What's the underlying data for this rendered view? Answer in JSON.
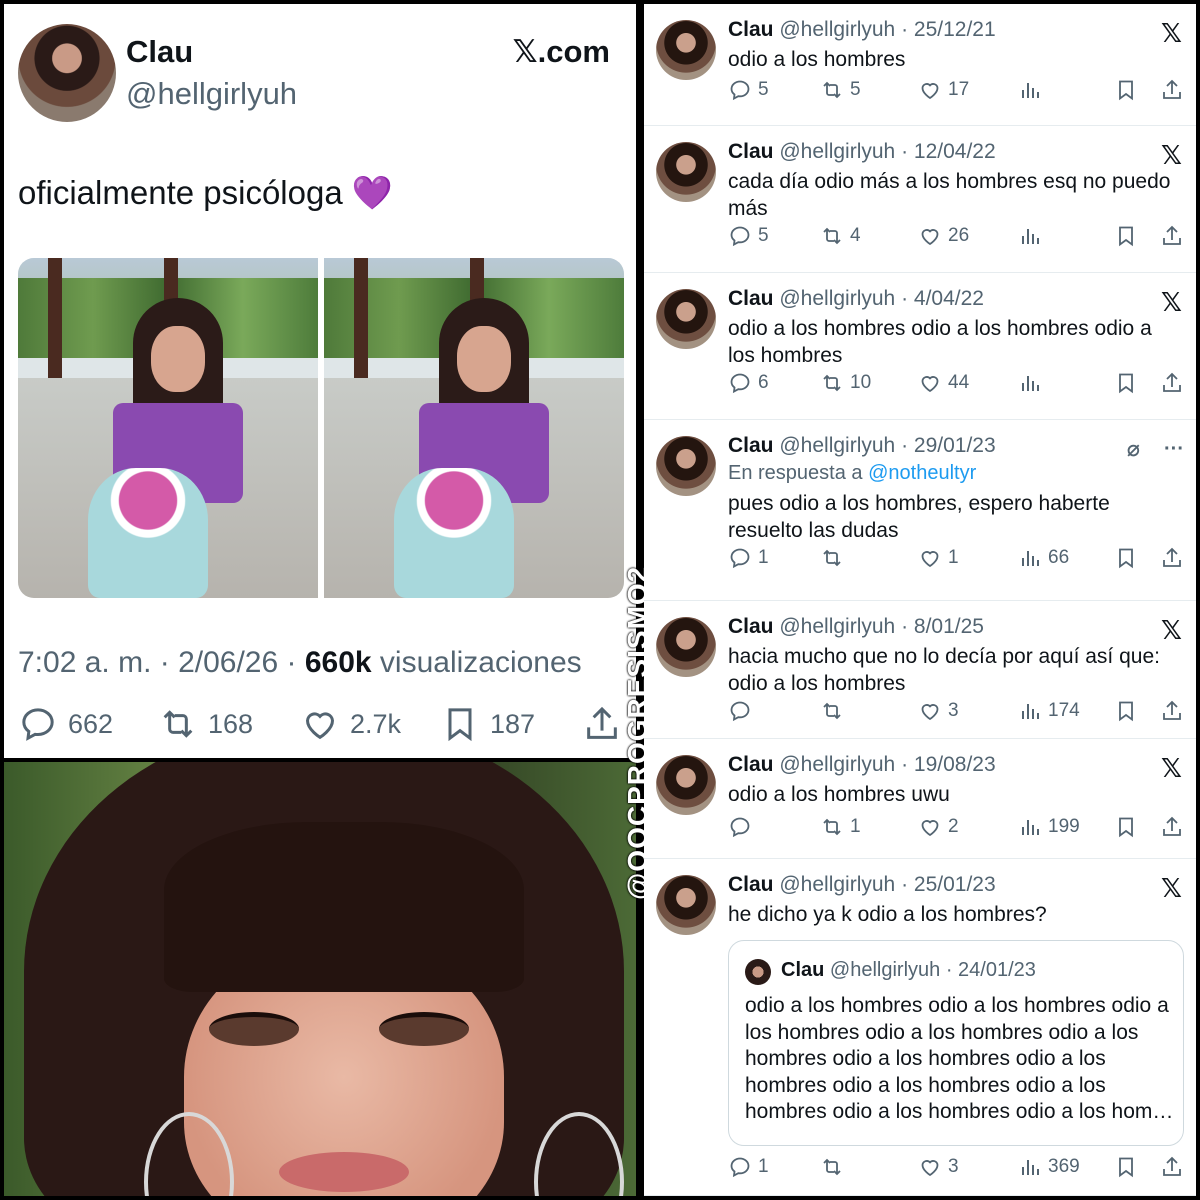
{
  "main": {
    "name": "Clau",
    "handle": "@hellgirlyuh",
    "site": "𝕏.com",
    "text": "oficialmente psicóloga",
    "emoji": "💜",
    "time": "7:02 a. m. · 2/06/26 · ",
    "views_count": "660k",
    "views_label": " visualizaciones",
    "replies": "662",
    "retweets": "168",
    "likes": "2.7k",
    "bookmarks": "187"
  },
  "watermark": "@OOCPROGRESISMO2",
  "tweets": [
    {
      "name": "Clau",
      "handle": "@hellgirlyuh",
      "date": "· 25/12/21",
      "text": "odio a los hombres",
      "replies": "5",
      "retweets": "5",
      "likes": "17",
      "views": ""
    },
    {
      "name": "Clau",
      "handle": "@hellgirlyuh",
      "date": "· 12/04/22",
      "text": "cada día odio más a los hombres esq no puedo más",
      "replies": "5",
      "retweets": "4",
      "likes": "26",
      "views": ""
    },
    {
      "name": "Clau",
      "handle": "@hellgirlyuh",
      "date": "· 4/04/22",
      "text": "odio a los hombres odio a los hombres odio a los hombres",
      "replies": "6",
      "retweets": "10",
      "likes": "44",
      "views": ""
    },
    {
      "name": "Clau",
      "handle": "@hellgirlyuh",
      "date": "· 29/01/23",
      "reply_prefix": "En respuesta a ",
      "reply_to": "@notheultyr",
      "text": "pues odio a los hombres, espero haberte resuelto las dudas",
      "replies": "1",
      "retweets": "",
      "likes": "1",
      "views": "66"
    },
    {
      "name": "Clau",
      "handle": "@hellgirlyuh",
      "date": "· 8/01/25",
      "text": "hacia mucho que no lo decía por aquí así que: odio a los hombres",
      "replies": "",
      "retweets": "",
      "likes": "3",
      "views": "174"
    },
    {
      "name": "Clau",
      "handle": "@hellgirlyuh",
      "date": "· 19/08/23",
      "text": "odio a los hombres uwu",
      "replies": "",
      "retweets": "1",
      "likes": "2",
      "views": "199"
    },
    {
      "name": "Clau",
      "handle": "@hellgirlyuh",
      "date": "· 25/01/23",
      "text": "he dicho ya k odio a los hombres?",
      "replies": "1",
      "retweets": "",
      "likes": "3",
      "views": "369"
    }
  ],
  "quote": {
    "name": "Clau",
    "handle": "@hellgirlyuh",
    "date": "· 24/01/23",
    "text": "odio a los hombres odio a los hombres odio a los hombres odio a los hombres odio a los hombres odio a los hombres odio a los hombres odio a los hombres odio a los hombres odio a los hombres odio a los hom…"
  },
  "icons": {
    "x_logo": "𝕏",
    "more": "···"
  }
}
